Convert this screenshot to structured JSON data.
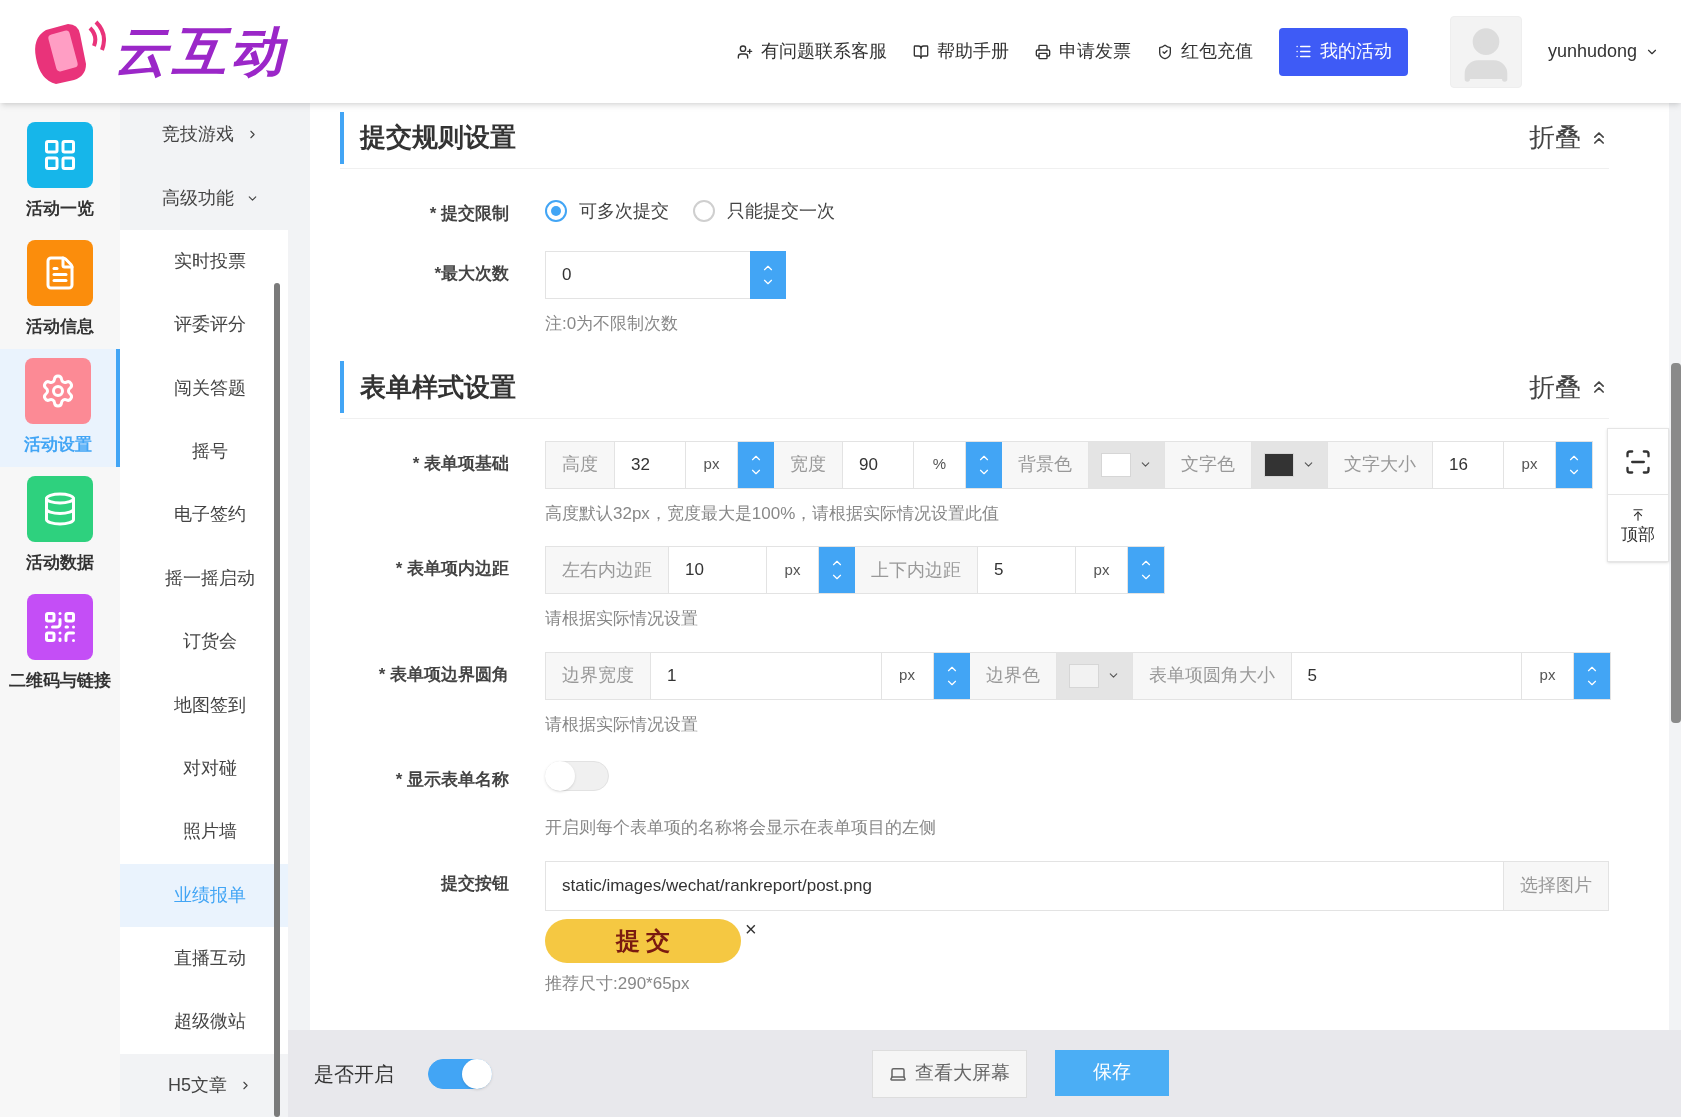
{
  "header": {
    "logo_text": "云互动",
    "nav": [
      {
        "label": "有问题联系客服"
      },
      {
        "label": "帮助手册"
      },
      {
        "label": "申请发票"
      },
      {
        "label": "红包充值"
      }
    ],
    "primary_button": "我的活动",
    "username": "yunhudong"
  },
  "sidebar": {
    "items": [
      {
        "label": "活动一览",
        "color": "#16b6ea",
        "selected": false
      },
      {
        "label": "活动信息",
        "color": "#fb8d0c",
        "selected": false
      },
      {
        "label": "活动设置",
        "color": "#fc8a95",
        "selected": true
      },
      {
        "label": "活动数据",
        "color": "#2ed17e",
        "selected": false
      },
      {
        "label": "二维码与链接",
        "color": "#c44ef6",
        "selected": false
      }
    ]
  },
  "submenu": {
    "items": [
      {
        "label": "竞技游戏",
        "kind": "group",
        "expanded": false,
        "selected": false
      },
      {
        "label": "高级功能",
        "kind": "group",
        "expanded": true,
        "selected": false
      },
      {
        "label": "实时投票",
        "kind": "item",
        "selected": false
      },
      {
        "label": "评委评分",
        "kind": "item",
        "selected": false
      },
      {
        "label": "闯关答题",
        "kind": "item",
        "selected": false
      },
      {
        "label": "摇号",
        "kind": "item",
        "selected": false
      },
      {
        "label": "电子签约",
        "kind": "item",
        "selected": false
      },
      {
        "label": "摇一摇启动",
        "kind": "item",
        "selected": false
      },
      {
        "label": "订货会",
        "kind": "item",
        "selected": false
      },
      {
        "label": "地图签到",
        "kind": "item",
        "selected": false
      },
      {
        "label": "对对碰",
        "kind": "item",
        "selected": false
      },
      {
        "label": "照片墙",
        "kind": "item",
        "selected": false
      },
      {
        "label": "业绩报单",
        "kind": "item",
        "selected": true
      },
      {
        "label": "直播互动",
        "kind": "item",
        "selected": false
      },
      {
        "label": "超级微站",
        "kind": "item",
        "selected": false
      },
      {
        "label": "H5文章",
        "kind": "group",
        "expanded": false,
        "selected": false
      }
    ]
  },
  "sections": [
    {
      "title": "提交规则设置",
      "collapse": "折叠",
      "fields": [
        {
          "kind": "radio",
          "label": "* 提交限制",
          "options": [
            {
              "label": "可多次提交",
              "selected": true
            },
            {
              "label": "只能提交一次",
              "selected": false
            }
          ]
        },
        {
          "kind": "number",
          "label": "*最大次数",
          "value": "0",
          "note": "注:0为不限制次数"
        }
      ]
    },
    {
      "title": "表单样式设置",
      "collapse": "折叠",
      "fields": [
        {
          "kind": "group",
          "label": "* 表单项基础",
          "segments": [
            {
              "kind": "addon",
              "text": "高度"
            },
            {
              "kind": "value",
              "text": "32"
            },
            {
              "kind": "unit",
              "text": "px"
            },
            {
              "kind": "spinner"
            },
            {
              "kind": "addon",
              "text": "宽度"
            },
            {
              "kind": "value",
              "text": "90"
            },
            {
              "kind": "unit",
              "text": "%"
            },
            {
              "kind": "spinner"
            },
            {
              "kind": "addon",
              "text": "背景色"
            },
            {
              "kind": "color",
              "color": "#ffffff"
            },
            {
              "kind": "addon",
              "text": "文字色"
            },
            {
              "kind": "color",
              "color": "#333333"
            },
            {
              "kind": "addon",
              "text": "文字大小"
            },
            {
              "kind": "value",
              "text": "16"
            },
            {
              "kind": "unit",
              "text": "px"
            },
            {
              "kind": "spinner"
            }
          ],
          "note": "高度默认32px，宽度最大是100%，请根据实际情况设置此值"
        },
        {
          "kind": "group",
          "label": "* 表单项内边距",
          "segments": [
            {
              "kind": "addon",
              "text": "左右内边距"
            },
            {
              "kind": "value",
              "text": "10"
            },
            {
              "kind": "unit",
              "text": "px"
            },
            {
              "kind": "spinner"
            },
            {
              "kind": "addon",
              "text": "上下内边距"
            },
            {
              "kind": "value",
              "text": "5"
            },
            {
              "kind": "unit",
              "text": "px"
            },
            {
              "kind": "spinner"
            }
          ],
          "note": "请根据实际情况设置"
        },
        {
          "kind": "group",
          "label": "* 表单项边界圆角",
          "segments": [
            {
              "kind": "addon",
              "text": "边界宽度"
            },
            {
              "kind": "value",
              "text": "1"
            },
            {
              "kind": "unit",
              "text": "px"
            },
            {
              "kind": "spinner"
            },
            {
              "kind": "addon",
              "text": "边界色"
            },
            {
              "kind": "color",
              "color": "#f2f2f2"
            },
            {
              "kind": "addon",
              "text": "表单项圆角大小"
            },
            {
              "kind": "value",
              "text": "5"
            },
            {
              "kind": "unit",
              "text": "px"
            },
            {
              "kind": "spinner"
            }
          ],
          "note": "请根据实际情况设置"
        },
        {
          "kind": "switch",
          "label": "* 显示表单名称",
          "on": false,
          "note": "开启则每个表单项的名称将会显示在表单项目的左侧"
        },
        {
          "kind": "image",
          "label": "提交按钮",
          "value": "static/images/wechat/rankreport/post.png",
          "button": "选择图片",
          "preview_text": "提 交",
          "remove": "×",
          "note": "推荐尺寸:290*65px"
        }
      ]
    }
  ],
  "float_tools": {
    "top_label": "顶部"
  },
  "footer": {
    "label": "是否开启",
    "on": true,
    "screen_button": "查看大屏幕",
    "save_button": "保存"
  }
}
